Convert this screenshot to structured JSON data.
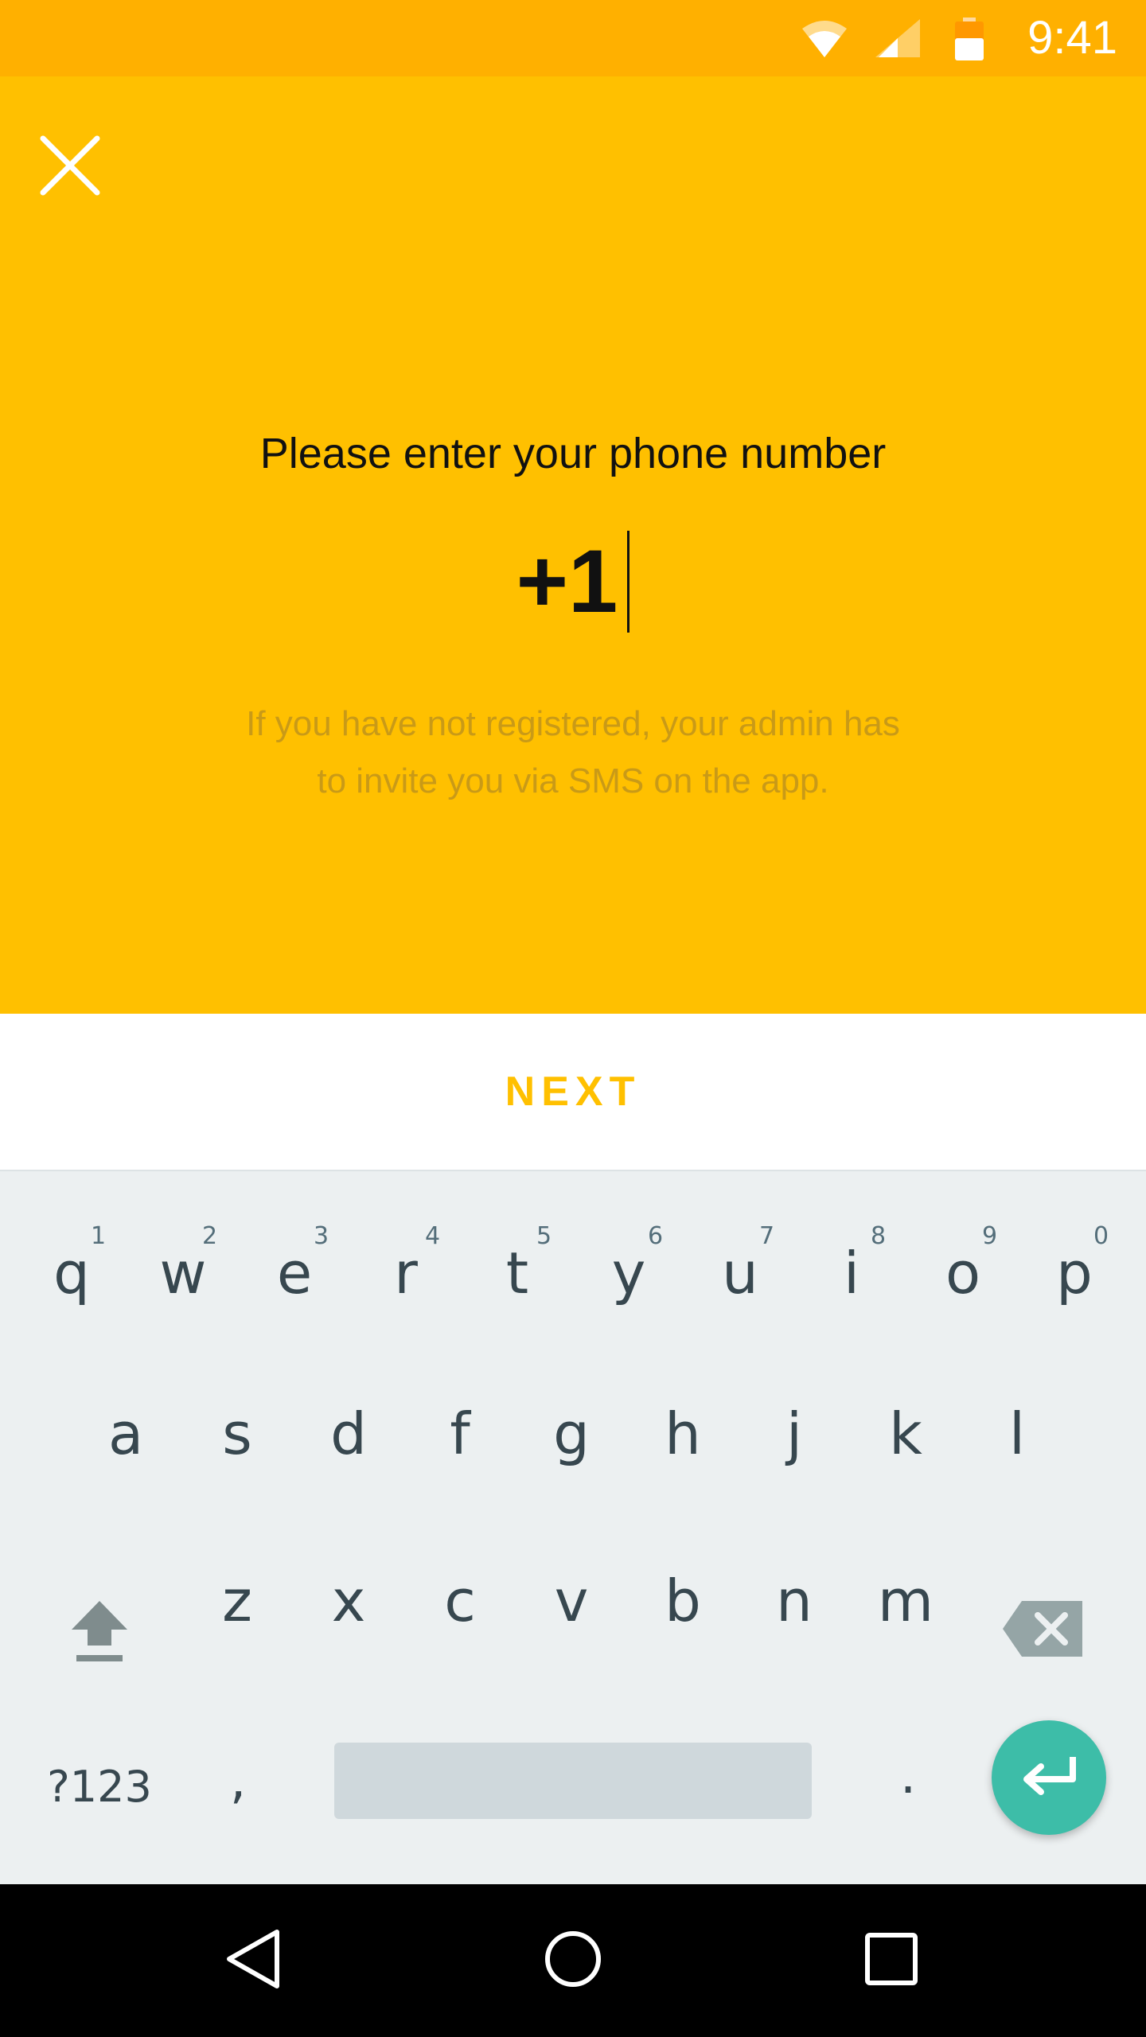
{
  "status_bar": {
    "time": "9:41",
    "icons": [
      "wifi-icon",
      "cell-signal-icon",
      "battery-icon"
    ],
    "background": "#FFB000"
  },
  "screen": {
    "background": "#FFC000",
    "close_icon": "close-icon",
    "prompt": "Please enter your phone number",
    "phone_input": {
      "value": "+1"
    },
    "hint_line1": "If you have not registered, your admin has",
    "hint_line2": "to invite you via SMS on the app."
  },
  "actions": {
    "next_label": "NEXT",
    "accent": "#FFC000"
  },
  "keyboard": {
    "row1": [
      {
        "letter": "q",
        "hint": "1"
      },
      {
        "letter": "w",
        "hint": "2"
      },
      {
        "letter": "e",
        "hint": "3"
      },
      {
        "letter": "r",
        "hint": "4"
      },
      {
        "letter": "t",
        "hint": "5"
      },
      {
        "letter": "y",
        "hint": "6"
      },
      {
        "letter": "u",
        "hint": "7"
      },
      {
        "letter": "i",
        "hint": "8"
      },
      {
        "letter": "o",
        "hint": "9"
      },
      {
        "letter": "p",
        "hint": "0"
      }
    ],
    "row2": [
      "a",
      "s",
      "d",
      "f",
      "g",
      "h",
      "j",
      "k",
      "l"
    ],
    "row3": [
      "z",
      "x",
      "c",
      "v",
      "b",
      "n",
      "m"
    ],
    "symbols_label": "?123",
    "comma": ",",
    "period": ".",
    "icons": [
      "shift-icon",
      "backspace-icon",
      "enter-icon"
    ],
    "enter_color": "#3DBDA8"
  },
  "nav_bar": {
    "icons": [
      "back-icon",
      "home-icon",
      "recents-icon"
    ]
  }
}
